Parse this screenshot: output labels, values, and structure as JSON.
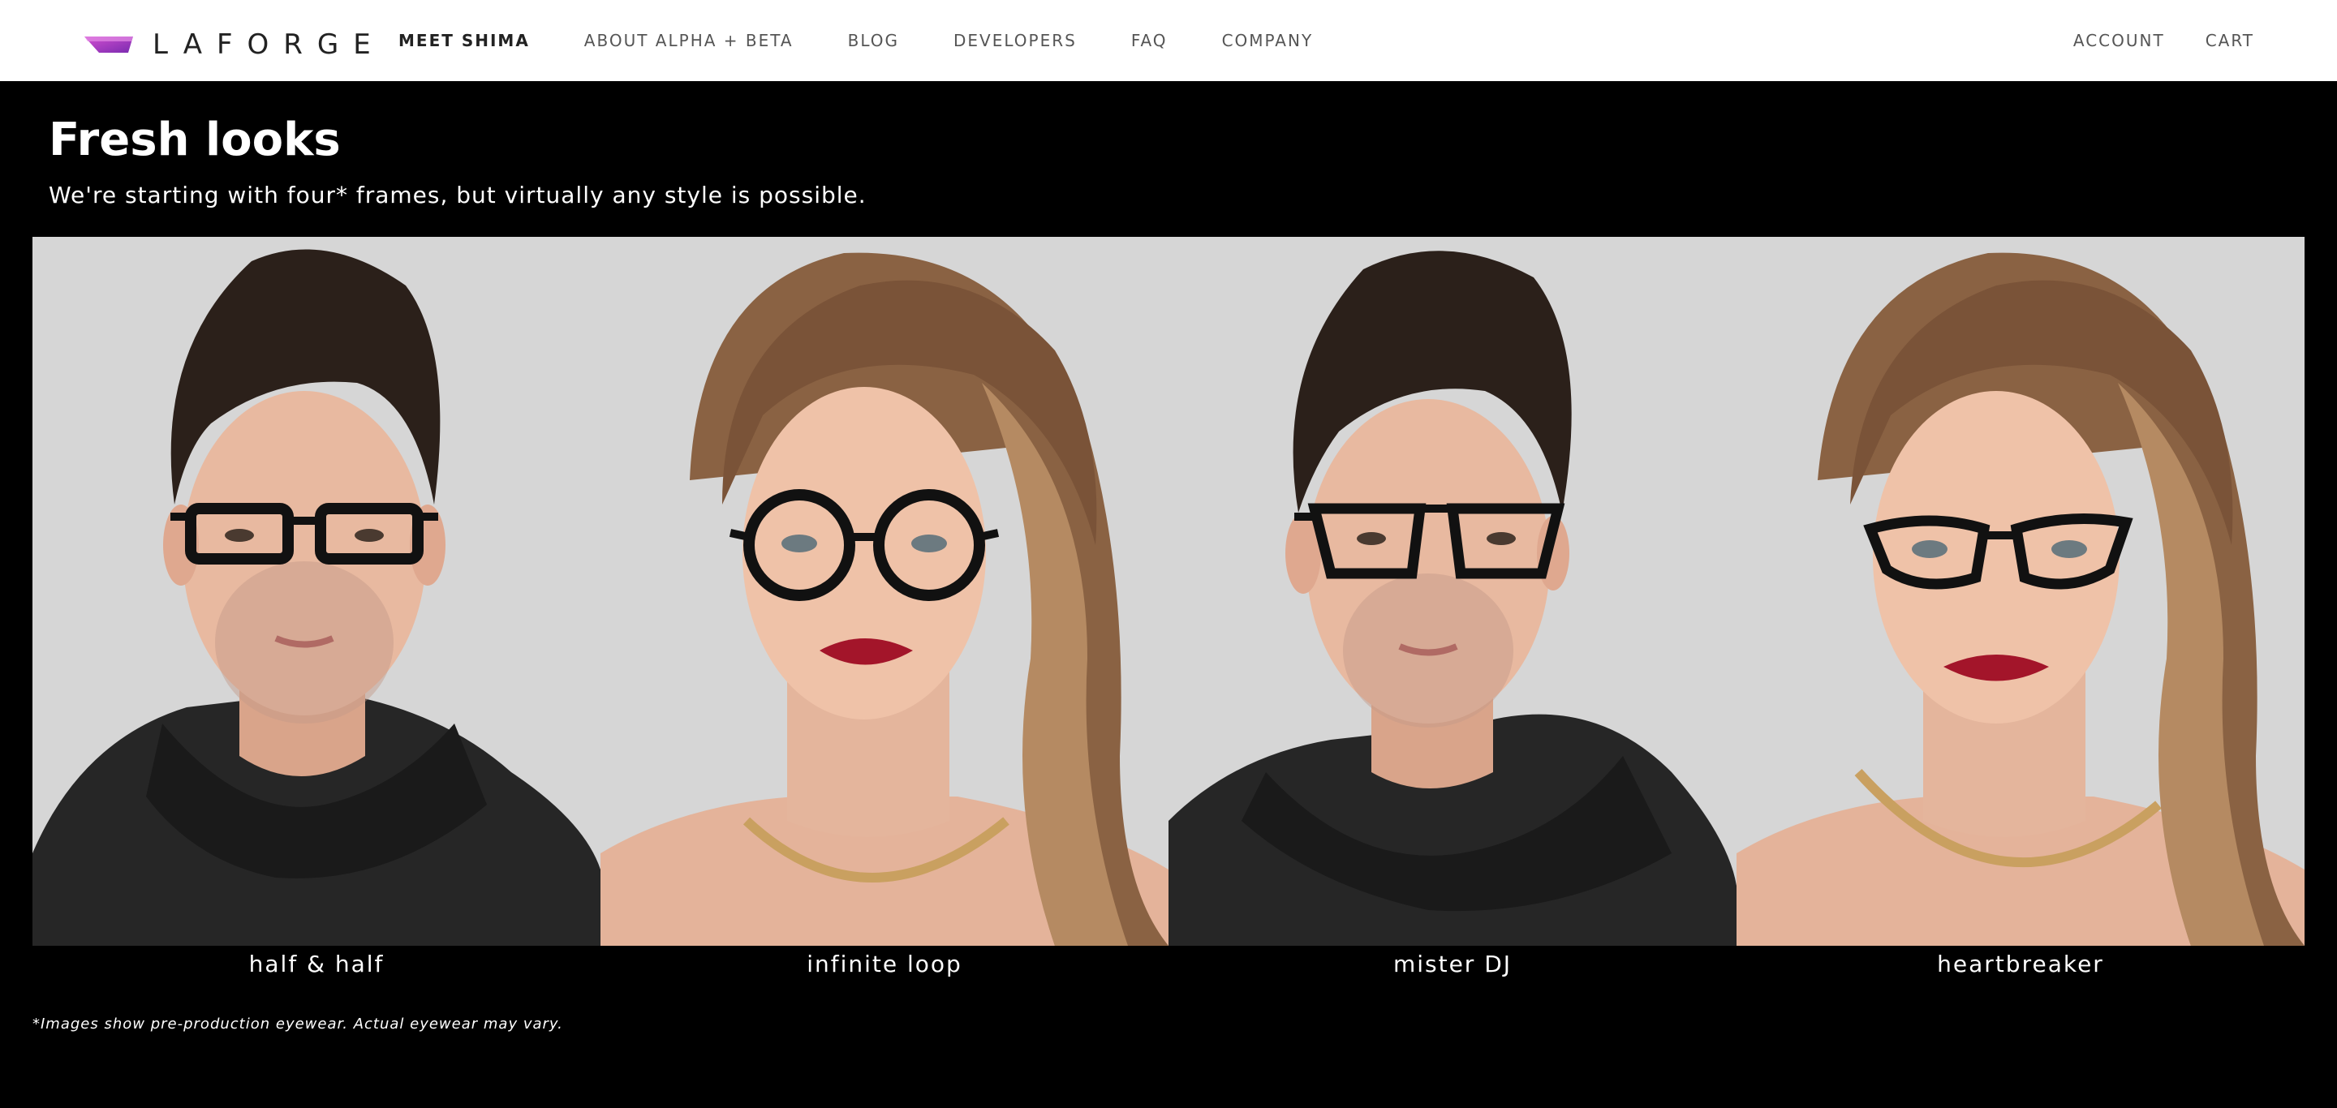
{
  "header": {
    "brand": "LAFORGE",
    "nav": [
      {
        "label": "MEET SHIMA",
        "active": true
      },
      {
        "label": "ABOUT ALPHA + BETA",
        "active": false
      },
      {
        "label": "BLOG",
        "active": false
      },
      {
        "label": "DEVELOPERS",
        "active": false
      },
      {
        "label": "FAQ",
        "active": false
      },
      {
        "label": "COMPANY",
        "active": false
      }
    ],
    "account_label": "ACCOUNT",
    "cart_label": "CART"
  },
  "hero": {
    "title": "Fresh looks",
    "subtitle": "We're starting with four* frames, but virtually any style is possible."
  },
  "gallery": {
    "frames": [
      {
        "name": "half & half",
        "model": "man",
        "glasses": "rectangular"
      },
      {
        "name": "infinite loop",
        "model": "woman",
        "glasses": "round"
      },
      {
        "name": "mister DJ",
        "model": "man",
        "glasses": "aviator-square"
      },
      {
        "name": "heartbreaker",
        "model": "woman",
        "glasses": "cat-eye"
      }
    ]
  },
  "footnote": "*Images show pre-production eyewear. Actual eyewear may vary.",
  "colors": {
    "header_bg": "#ffffff",
    "page_bg": "#000000",
    "gallery_bg": "#d6d6d6",
    "logo_purple": "#a03dc8",
    "logo_magenta": "#d44fd0"
  }
}
